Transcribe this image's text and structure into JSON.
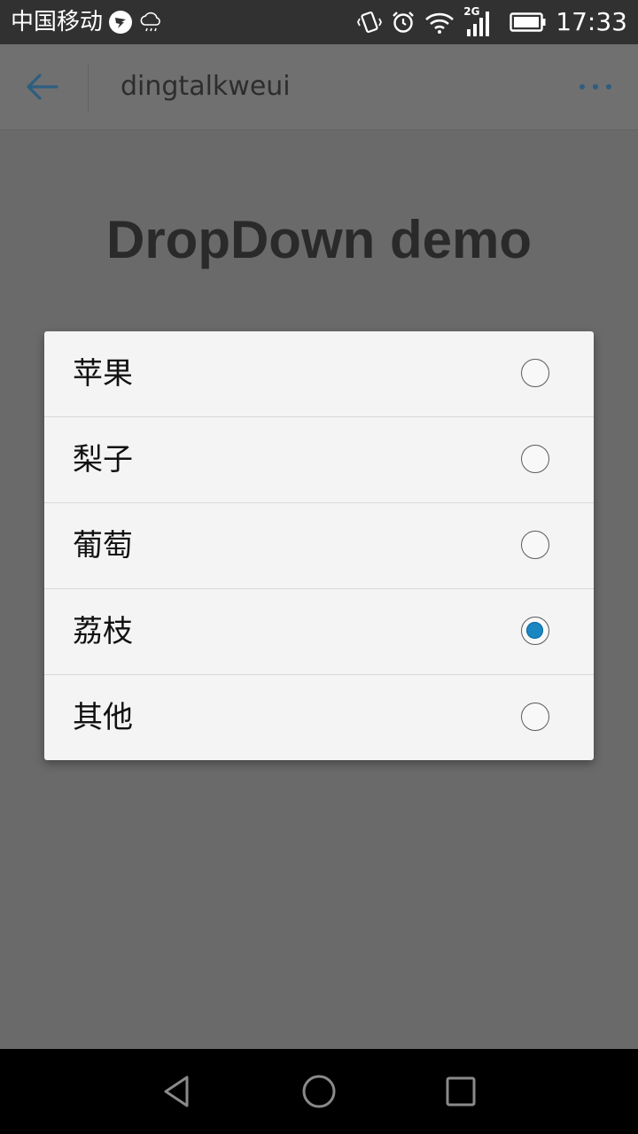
{
  "status_bar": {
    "carrier": "中国移动",
    "network_label": "2G",
    "time": "17:33"
  },
  "app_bar": {
    "title": "dingtalkweui",
    "back_icon": "arrow-left-icon",
    "more_icon": "more-horizontal-icon"
  },
  "page": {
    "heading": "DropDown demo"
  },
  "dropdown": {
    "options": [
      {
        "label": "苹果",
        "selected": false
      },
      {
        "label": "梨子",
        "selected": false
      },
      {
        "label": "葡萄",
        "selected": false
      },
      {
        "label": "荔枝",
        "selected": true
      },
      {
        "label": "其他",
        "selected": false
      }
    ]
  },
  "colors": {
    "accent": "#1a86c2",
    "overlay": "#6a6a6a",
    "dialog_bg": "#f4f4f4",
    "back_icon": "#2c5e80"
  }
}
